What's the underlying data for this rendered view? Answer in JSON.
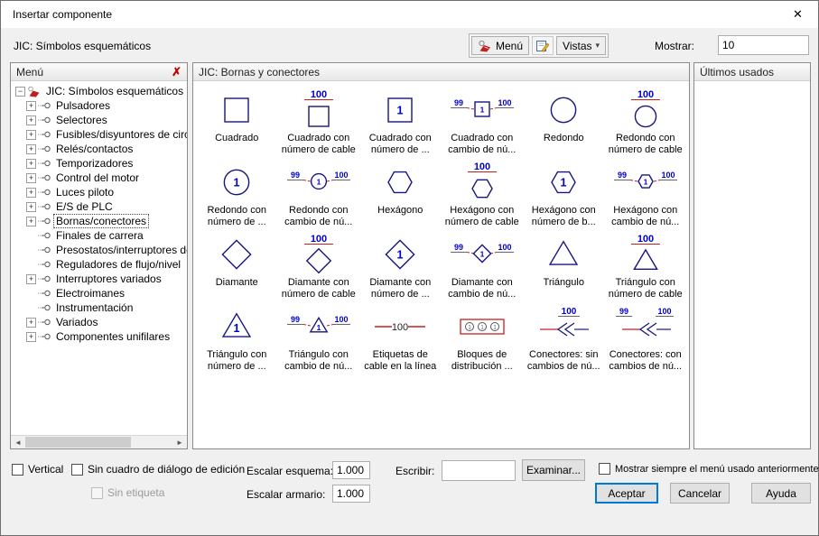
{
  "window": {
    "title": "Insertar componente"
  },
  "icons": {
    "close": "✕",
    "panel_close": "✗",
    "dropdown": "▾",
    "scroll_left": "◄",
    "scroll_right": "►",
    "collapse": "−",
    "expand": "+"
  },
  "toolbar": {
    "catalog_label": "JIC: Símbolos esquemáticos",
    "menu_button": "Menú",
    "views_button": "Vistas",
    "show_label": "Mostrar:",
    "show_value": "10"
  },
  "tree": {
    "header": "Menú",
    "root_label": "JIC: Símbolos esquemáticos",
    "items": [
      {
        "label": "Pulsadores",
        "plus": true
      },
      {
        "label": "Selectores",
        "plus": true
      },
      {
        "label": "Fusibles/disyuntores de circu",
        "plus": true
      },
      {
        "label": "Relés/contactos",
        "plus": true
      },
      {
        "label": "Temporizadores",
        "plus": true
      },
      {
        "label": "Control del motor",
        "plus": true
      },
      {
        "label": "Luces piloto",
        "plus": true
      },
      {
        "label": "E/S de PLC",
        "plus": true
      },
      {
        "label": "Bornas/conectores",
        "plus": true,
        "selected": true
      },
      {
        "label": "Finales de carrera",
        "plus": false
      },
      {
        "label": "Presostatos/interruptores de",
        "plus": false
      },
      {
        "label": "Reguladores de flujo/nivel",
        "plus": false
      },
      {
        "label": "Interruptores variados",
        "plus": true
      },
      {
        "label": "Electroimanes",
        "plus": false
      },
      {
        "label": "Instrumentación",
        "plus": false
      },
      {
        "label": "Variados",
        "plus": true
      },
      {
        "label": "Componentes unifilares",
        "plus": true
      }
    ]
  },
  "grid": {
    "header": "JIC: Bornas y conectores",
    "items": [
      {
        "label": "Cuadrado",
        "symbol": "square-plain"
      },
      {
        "label": "Cuadrado con número de cable",
        "symbol": "square-wire",
        "num": "100"
      },
      {
        "label": "Cuadrado con número de ...",
        "symbol": "square-num",
        "inner": "1"
      },
      {
        "label": "Cuadrado con cambio de nú...",
        "symbol": "square-change",
        "left": "99",
        "right": "100",
        "inner": "1"
      },
      {
        "label": "Redondo",
        "symbol": "circle-plain"
      },
      {
        "label": "Redondo con número de cable",
        "symbol": "circle-wire",
        "num": "100"
      },
      {
        "label": "Redondo con número de ...",
        "symbol": "circle-num",
        "inner": "1"
      },
      {
        "label": "Redondo con cambio de nú...",
        "symbol": "circle-change",
        "left": "99",
        "right": "100",
        "inner": "1"
      },
      {
        "label": "Hexágono",
        "symbol": "hex-plain"
      },
      {
        "label": "Hexágono con número de cable",
        "symbol": "hex-wire",
        "num": "100"
      },
      {
        "label": "Hexágono con número de b...",
        "symbol": "hex-num",
        "inner": "1"
      },
      {
        "label": "Hexágono con cambio de nú...",
        "symbol": "hex-change",
        "left": "99",
        "right": "100",
        "inner": "1"
      },
      {
        "label": "Diamante",
        "symbol": "diamond-plain"
      },
      {
        "label": "Diamante con número de cable",
        "symbol": "diamond-wire",
        "num": "100"
      },
      {
        "label": "Diamante con número de ...",
        "symbol": "diamond-num",
        "inner": "1"
      },
      {
        "label": "Diamante con cambio de nú...",
        "symbol": "diamond-change",
        "left": "99",
        "right": "100",
        "inner": "1"
      },
      {
        "label": "Triángulo",
        "symbol": "tri-plain"
      },
      {
        "label": "Triángulo con número de cable",
        "symbol": "tri-wire",
        "num": "100"
      },
      {
        "label": "Triángulo con número de ...",
        "symbol": "tri-num",
        "inner": "1"
      },
      {
        "label": "Triángulo con cambio de nú...",
        "symbol": "tri-change",
        "left": "99",
        "right": "100",
        "inner": "1"
      },
      {
        "label": "Etiquetas de cable en la línea",
        "symbol": "wire-label",
        "num": "100"
      },
      {
        "label": "Bloques de distribución ...",
        "symbol": "dist-block"
      },
      {
        "label": "Conectores: sin cambios de nú...",
        "symbol": "conn-plain",
        "num": "100"
      },
      {
        "label": "Conectores: con cambios de nú...",
        "symbol": "conn-change",
        "left": "99",
        "right": "100"
      }
    ]
  },
  "recent": {
    "header": "Últimos usados"
  },
  "footer": {
    "vertical_label": "Vertical",
    "no_edit_dialog_label": "Sin cuadro de diálogo de edición",
    "no_tag_label": "Sin etiqueta",
    "scale_schematic_label": "Escalar esquema:",
    "scale_schematic_value": "1.000",
    "scale_panel_label": "Escalar armario:",
    "scale_panel_value": "1.000",
    "type_label": "Escribir:",
    "type_value": "",
    "browse_button": "Examinar...",
    "always_show_label": "Mostrar siempre el menú usado anteriormente",
    "ok_button": "Aceptar",
    "cancel_button": "Cancelar",
    "help_button": "Ayuda"
  },
  "colors": {
    "symbol_outline": "#16167f",
    "number_blue": "#0000cd",
    "accent_red": "#c22020"
  }
}
